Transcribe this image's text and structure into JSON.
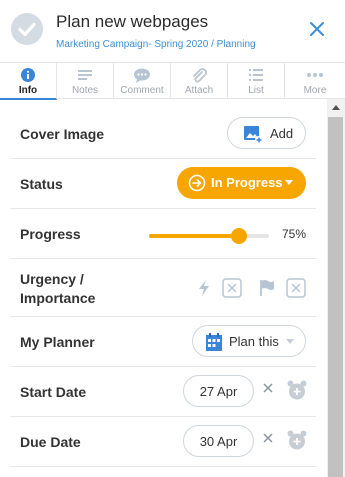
{
  "header": {
    "title": "Plan new webpages",
    "subtitle": "Marketing Campaign- Spring 2020 / Planning"
  },
  "tabs": [
    {
      "label": "Info",
      "icon": "info-icon",
      "active": true
    },
    {
      "label": "Notes",
      "icon": "notes-icon",
      "active": false
    },
    {
      "label": "Comment",
      "icon": "comment-icon",
      "active": false
    },
    {
      "label": "Attach",
      "icon": "attach-icon",
      "active": false
    },
    {
      "label": "List",
      "icon": "list-icon",
      "active": false
    },
    {
      "label": "More",
      "icon": "more-icon",
      "active": false
    }
  ],
  "fields": {
    "cover": {
      "label": "Cover Image",
      "button": "Add"
    },
    "status": {
      "label": "Status",
      "value": "In Progress"
    },
    "progress": {
      "label": "Progress",
      "value": 0.75,
      "display": "75%"
    },
    "urgency": {
      "label_line1": "Urgency /",
      "label_line2": "Importance"
    },
    "planner": {
      "label": "My Planner",
      "button": "Plan this"
    },
    "start_date": {
      "label": "Start Date",
      "value": "27 Apr"
    },
    "due_date": {
      "label": "Due Date",
      "value": "30 Apr"
    }
  },
  "colors": {
    "accent": "#3a85d8",
    "status": "#f7a600",
    "icon_muted": "#b7c5d3"
  }
}
